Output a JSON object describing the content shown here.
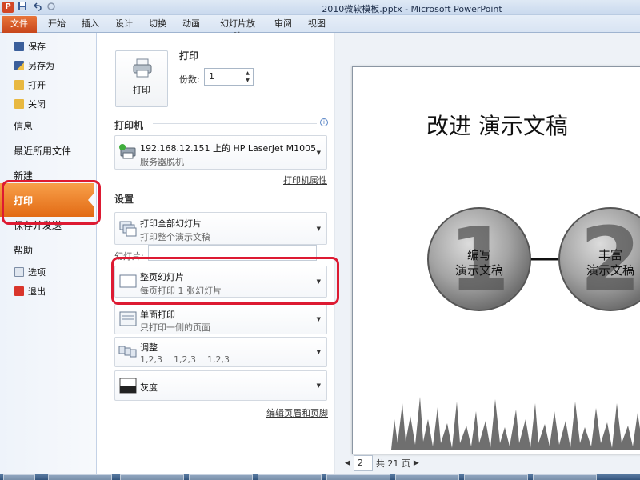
{
  "window": {
    "app_icon": "P",
    "title": "2010微软模板.pptx - Microsoft PowerPoint",
    "qat_icons": [
      "save-icon",
      "undo-icon",
      "redo-icon"
    ]
  },
  "ribbon": {
    "tabs": [
      "文件",
      "开始",
      "插入",
      "设计",
      "切换",
      "动画",
      "幻灯片放映",
      "审阅",
      "视图"
    ]
  },
  "backstage": {
    "small_items": [
      "保存",
      "另存为",
      "打开",
      "关闭"
    ],
    "big_items": [
      "信息",
      "最近所用文件",
      "新建",
      "打印",
      "保存并发送",
      "帮助"
    ],
    "bottom_items": [
      "选项",
      "退出"
    ]
  },
  "print": {
    "heading": "打印",
    "button_label": "打印",
    "copies_label": "份数:",
    "copies_value": "1",
    "printer_section": "打印机",
    "printer_name": "192.168.12.151 上的 HP LaserJet M1005",
    "printer_status": "服务器脱机",
    "printer_props_link": "打印机属性",
    "settings_section": "设置",
    "range_main": "打印全部幻灯片",
    "range_sub": "打印整个演示文稿",
    "slides_label": "幻灯片:",
    "layout_main": "整页幻灯片",
    "layout_sub": "每页打印 1 张幻灯片",
    "sides_main": "单面打印",
    "sides_sub": "只打印一侧的页面",
    "collate_main": "调整",
    "collate_sub": "1,2,3    1,2,3    1,2,3",
    "color_main": "灰度",
    "header_footer_link": "编辑页眉和页脚"
  },
  "preview": {
    "slide_title": "改进 演示文稿",
    "step1_number": "1",
    "step1_label_line1": "编写",
    "step1_label_line2": "演示文稿",
    "step2_number": "2",
    "step2_label_line1": "丰富",
    "step2_label_line2": "演示文稿",
    "page_value": "2",
    "page_total": "共 21 页"
  },
  "colors": {
    "file_tab": "#d8541f",
    "print_selected": "#ee7d22",
    "annotation_red": "#dd1a32",
    "ribbon_bg": "#dfe8f4"
  }
}
